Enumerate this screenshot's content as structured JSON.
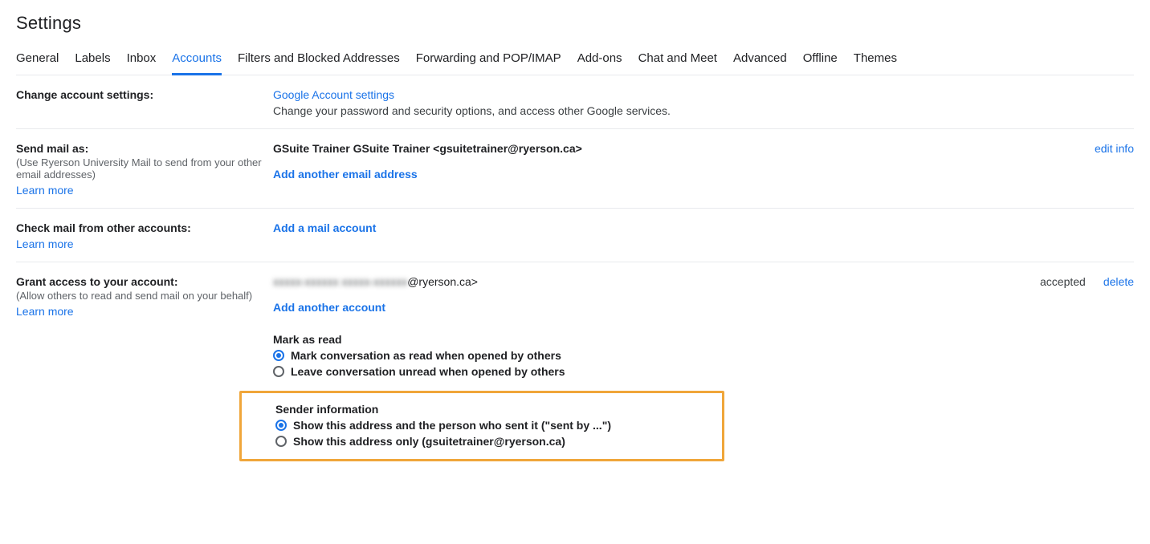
{
  "page_title": "Settings",
  "tabs": {
    "general": "General",
    "labels": "Labels",
    "inbox": "Inbox",
    "accounts": "Accounts",
    "filters": "Filters and Blocked Addresses",
    "forwarding": "Forwarding and POP/IMAP",
    "addons": "Add-ons",
    "chat": "Chat and Meet",
    "advanced": "Advanced",
    "offline": "Offline",
    "themes": "Themes"
  },
  "change_account": {
    "label": "Change account settings:",
    "link": "Google Account settings",
    "desc": "Change your password and security options, and access other Google services."
  },
  "send_mail_as": {
    "label": "Send mail as:",
    "sub": "(Use Ryerson University Mail to send from your other email addresses)",
    "learn_more": "Learn more",
    "identity": "GSuite Trainer GSuite Trainer <gsuitetrainer@ryerson.ca>",
    "edit_info": "edit info",
    "add_link": "Add another email address"
  },
  "check_mail": {
    "label": "Check mail from other accounts:",
    "learn_more": "Learn more",
    "add_link": "Add a mail account"
  },
  "grant_access": {
    "label": "Grant access to your account:",
    "sub": "(Allow others to read and send mail on your behalf)",
    "learn_more": "Learn more",
    "delegate_blurred": "xxxxx-xxxxxx xxxxx-xxxxxx",
    "delegate_suffix": "@ryerson.ca>",
    "status": "accepted",
    "delete": "delete",
    "add_link": "Add another account",
    "mark_heading": "Mark as read",
    "mark_opt1": "Mark conversation as read when opened by others",
    "mark_opt2": "Leave conversation unread when opened by others",
    "sender_heading": "Sender information",
    "sender_opt1": "Show this address and the person who sent it (\"sent by ...\")",
    "sender_opt2": "Show this address only (gsuitetrainer@ryerson.ca)"
  }
}
